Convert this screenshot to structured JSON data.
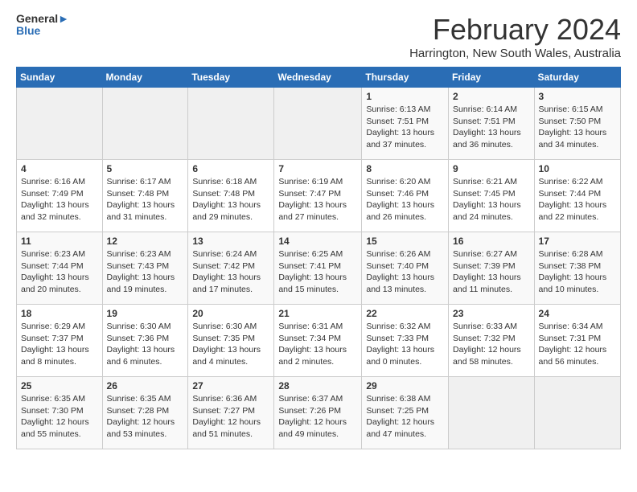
{
  "logo": {
    "line1": "General",
    "line2": "Blue"
  },
  "title": "February 2024",
  "location": "Harrington, New South Wales, Australia",
  "days_of_week": [
    "Sunday",
    "Monday",
    "Tuesday",
    "Wednesday",
    "Thursday",
    "Friday",
    "Saturday"
  ],
  "weeks": [
    [
      {
        "day": "",
        "detail": ""
      },
      {
        "day": "",
        "detail": ""
      },
      {
        "day": "",
        "detail": ""
      },
      {
        "day": "",
        "detail": ""
      },
      {
        "day": "1",
        "detail": "Sunrise: 6:13 AM\nSunset: 7:51 PM\nDaylight: 13 hours\nand 37 minutes."
      },
      {
        "day": "2",
        "detail": "Sunrise: 6:14 AM\nSunset: 7:51 PM\nDaylight: 13 hours\nand 36 minutes."
      },
      {
        "day": "3",
        "detail": "Sunrise: 6:15 AM\nSunset: 7:50 PM\nDaylight: 13 hours\nand 34 minutes."
      }
    ],
    [
      {
        "day": "4",
        "detail": "Sunrise: 6:16 AM\nSunset: 7:49 PM\nDaylight: 13 hours\nand 32 minutes."
      },
      {
        "day": "5",
        "detail": "Sunrise: 6:17 AM\nSunset: 7:48 PM\nDaylight: 13 hours\nand 31 minutes."
      },
      {
        "day": "6",
        "detail": "Sunrise: 6:18 AM\nSunset: 7:48 PM\nDaylight: 13 hours\nand 29 minutes."
      },
      {
        "day": "7",
        "detail": "Sunrise: 6:19 AM\nSunset: 7:47 PM\nDaylight: 13 hours\nand 27 minutes."
      },
      {
        "day": "8",
        "detail": "Sunrise: 6:20 AM\nSunset: 7:46 PM\nDaylight: 13 hours\nand 26 minutes."
      },
      {
        "day": "9",
        "detail": "Sunrise: 6:21 AM\nSunset: 7:45 PM\nDaylight: 13 hours\nand 24 minutes."
      },
      {
        "day": "10",
        "detail": "Sunrise: 6:22 AM\nSunset: 7:44 PM\nDaylight: 13 hours\nand 22 minutes."
      }
    ],
    [
      {
        "day": "11",
        "detail": "Sunrise: 6:23 AM\nSunset: 7:44 PM\nDaylight: 13 hours\nand 20 minutes."
      },
      {
        "day": "12",
        "detail": "Sunrise: 6:23 AM\nSunset: 7:43 PM\nDaylight: 13 hours\nand 19 minutes."
      },
      {
        "day": "13",
        "detail": "Sunrise: 6:24 AM\nSunset: 7:42 PM\nDaylight: 13 hours\nand 17 minutes."
      },
      {
        "day": "14",
        "detail": "Sunrise: 6:25 AM\nSunset: 7:41 PM\nDaylight: 13 hours\nand 15 minutes."
      },
      {
        "day": "15",
        "detail": "Sunrise: 6:26 AM\nSunset: 7:40 PM\nDaylight: 13 hours\nand 13 minutes."
      },
      {
        "day": "16",
        "detail": "Sunrise: 6:27 AM\nSunset: 7:39 PM\nDaylight: 13 hours\nand 11 minutes."
      },
      {
        "day": "17",
        "detail": "Sunrise: 6:28 AM\nSunset: 7:38 PM\nDaylight: 13 hours\nand 10 minutes."
      }
    ],
    [
      {
        "day": "18",
        "detail": "Sunrise: 6:29 AM\nSunset: 7:37 PM\nDaylight: 13 hours\nand 8 minutes."
      },
      {
        "day": "19",
        "detail": "Sunrise: 6:30 AM\nSunset: 7:36 PM\nDaylight: 13 hours\nand 6 minutes."
      },
      {
        "day": "20",
        "detail": "Sunrise: 6:30 AM\nSunset: 7:35 PM\nDaylight: 13 hours\nand 4 minutes."
      },
      {
        "day": "21",
        "detail": "Sunrise: 6:31 AM\nSunset: 7:34 PM\nDaylight: 13 hours\nand 2 minutes."
      },
      {
        "day": "22",
        "detail": "Sunrise: 6:32 AM\nSunset: 7:33 PM\nDaylight: 13 hours\nand 0 minutes."
      },
      {
        "day": "23",
        "detail": "Sunrise: 6:33 AM\nSunset: 7:32 PM\nDaylight: 12 hours\nand 58 minutes."
      },
      {
        "day": "24",
        "detail": "Sunrise: 6:34 AM\nSunset: 7:31 PM\nDaylight: 12 hours\nand 56 minutes."
      }
    ],
    [
      {
        "day": "25",
        "detail": "Sunrise: 6:35 AM\nSunset: 7:30 PM\nDaylight: 12 hours\nand 55 minutes."
      },
      {
        "day": "26",
        "detail": "Sunrise: 6:35 AM\nSunset: 7:28 PM\nDaylight: 12 hours\nand 53 minutes."
      },
      {
        "day": "27",
        "detail": "Sunrise: 6:36 AM\nSunset: 7:27 PM\nDaylight: 12 hours\nand 51 minutes."
      },
      {
        "day": "28",
        "detail": "Sunrise: 6:37 AM\nSunset: 7:26 PM\nDaylight: 12 hours\nand 49 minutes."
      },
      {
        "day": "29",
        "detail": "Sunrise: 6:38 AM\nSunset: 7:25 PM\nDaylight: 12 hours\nand 47 minutes."
      },
      {
        "day": "",
        "detail": ""
      },
      {
        "day": "",
        "detail": ""
      }
    ]
  ]
}
